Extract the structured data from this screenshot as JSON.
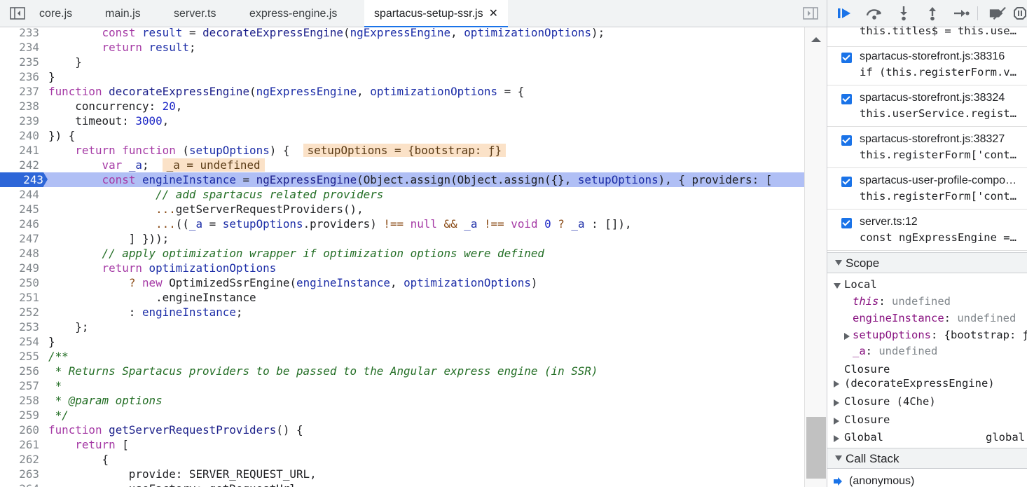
{
  "tabs": [
    {
      "label": "core.js"
    },
    {
      "label": "main.js"
    },
    {
      "label": "server.ts"
    },
    {
      "label": "express-engine.js"
    },
    {
      "label": "spartacus-setup-ssr.js",
      "close": "✕"
    }
  ],
  "editor": {
    "lines": [
      {
        "n": "233",
        "code": "        const result = decorateExpressEngine(ngExpressEngine, optimizationOptions);"
      },
      {
        "n": "234",
        "code": "        return result;"
      },
      {
        "n": "235",
        "code": "    }"
      },
      {
        "n": "236",
        "code": "}"
      },
      {
        "n": "237",
        "code": "function decorateExpressEngine(ngExpressEngine, optimizationOptions = {"
      },
      {
        "n": "238",
        "code": "    concurrency: 20,"
      },
      {
        "n": "239",
        "code": "    timeout: 3000,"
      },
      {
        "n": "240",
        "code": "}) {"
      },
      {
        "n": "241",
        "code": "    return function (setupOptions) {",
        "inline": "setupOptions = {bootstrap: ƒ}"
      },
      {
        "n": "242",
        "code": "        var _a;",
        "inline": "_a = undefined"
      },
      {
        "n": "243",
        "code": "        const engineInstance = ngExpressEngine(Object.assign(Object.assign({}, setupOptions), { providers: ["
      },
      {
        "n": "244",
        "code": "                // add spartacus related providers"
      },
      {
        "n": "245",
        "code": "                ...getServerRequestProviders(),"
      },
      {
        "n": "246",
        "code": "                ...((_a = setupOptions.providers) !== null && _a !== void 0 ? _a : []),"
      },
      {
        "n": "247",
        "code": "            ] }));"
      },
      {
        "n": "248",
        "code": "        // apply optimization wrapper if optimization options were defined"
      },
      {
        "n": "249",
        "code": "        return optimizationOptions"
      },
      {
        "n": "250",
        "code": "            ? new OptimizedSsrEngine(engineInstance, optimizationOptions)"
      },
      {
        "n": "251",
        "code": "                .engineInstance"
      },
      {
        "n": "252",
        "code": "            : engineInstance;"
      },
      {
        "n": "253",
        "code": "    };"
      },
      {
        "n": "254",
        "code": "}"
      },
      {
        "n": "255",
        "code": "/**"
      },
      {
        "n": "256",
        "code": " * Returns Spartacus providers to be passed to the Angular express engine (in SSR)"
      },
      {
        "n": "257",
        "code": " *"
      },
      {
        "n": "258",
        "code": " * @param options"
      },
      {
        "n": "259",
        "code": " */"
      },
      {
        "n": "260",
        "code": "function getServerRequestProviders() {"
      },
      {
        "n": "261",
        "code": "    return ["
      },
      {
        "n": "262",
        "code": "        {"
      },
      {
        "n": "263",
        "code": "            provide: SERVER_REQUEST_URL,"
      },
      {
        "n": "264",
        "code": "            useFactory: getRequestUrl,"
      }
    ]
  },
  "breakpoints": [
    {
      "location": "",
      "source": "this.titles$ = this.userService.titles$"
    },
    {
      "location": "spartacus-storefront.js:38316",
      "source": "if (this.registerForm.valid) {"
    },
    {
      "location": "spartacus-storefront.js:38324",
      "source": "this.userService.register({"
    },
    {
      "location": "spartacus-storefront.js:38327",
      "source": "this.registerForm['controls'].email"
    },
    {
      "location": "spartacus-user-profile-components.js",
      "source": "this.registerForm['controls']"
    },
    {
      "location": "server.ts:12",
      "source": "const ngExpressEngine = ..."
    }
  ],
  "scope": {
    "header": "Scope",
    "local_label": "Local",
    "vars": [
      {
        "key": "this",
        "sep": ": ",
        "value": "undefined"
      },
      {
        "key": "engineInstance",
        "sep": ": ",
        "value": "undefined"
      },
      {
        "key": "setupOptions",
        "sep": ": ",
        "value": "{bootstrap: ƒ}"
      },
      {
        "key": "_a",
        "sep": ": ",
        "value": "undefined"
      }
    ],
    "closure1_a": "Closure",
    "closure1_b": "(decorateExpressEngine)",
    "closure2": "Closure (4Che)",
    "closure3": "Closure",
    "global_label": "Global",
    "global_value": "global"
  },
  "callstack": {
    "header": "Call Stack",
    "first": "(anonymous)"
  }
}
